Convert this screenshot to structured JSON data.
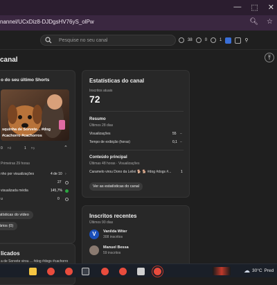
{
  "browser": {
    "url": "nannel/UCxDiz8-DJDgsHV76yS_olPw",
    "controls": [
      "—",
      "⬚",
      "✕"
    ]
  },
  "header": {
    "search_placeholder": "Pesquise no seu canal",
    "stats": [
      "38",
      "0",
      "1"
    ]
  },
  "page": {
    "title": "canal"
  },
  "latest_short": {
    "title": "o do seu último Shorts",
    "video_caption_1": "squinha de Sorvete... #dog",
    "video_caption_2": "#cachorro #cachorros",
    "stat_counts": [
      "0",
      "1"
    ],
    "period": "Primeiras 29 horas",
    "metrics": [
      {
        "label": "nho por visualizações",
        "value": "4 de 10"
      },
      {
        "label": "",
        "value": "27"
      },
      {
        "label": "visualizada média",
        "value": "145,7%"
      },
      {
        "label": "u",
        "value": "0"
      }
    ],
    "analytics_button": "atísticas do vídeo",
    "comments_button": "ários (0)"
  },
  "channel_stats": {
    "title": "Estatísticas do canal",
    "subs_label": "Inscritos atuais",
    "subs_value": "72",
    "summary_title": "Resumo",
    "summary_period": "Últimos 28 dias",
    "rows": [
      {
        "label": "Visualizações",
        "value": "55"
      },
      {
        "label": "Tempo de exibição (horas)",
        "value": "0,1"
      }
    ],
    "top_title": "Conteúdo principal",
    "top_period": "Últimas 48 horas · Visualizações",
    "top_item": "Caramelo virou Dono da Leilei 🐕 🐕 #dog #dogs #...",
    "top_item_value": "1",
    "stats_button": "Ver as estatísticas do canal"
  },
  "recent_subs": {
    "title": "Inscritos recentes",
    "period": "Últimos 90 dias",
    "items": [
      {
        "name": "Vanilda Witer",
        "subs": "308 inscritos",
        "color": "#1a4fb8"
      },
      {
        "name": "Manuel Bessa",
        "subs": "59 inscritos",
        "color": "#8a7a70"
      }
    ]
  },
  "published": {
    "title": "licados",
    "line": "a de Sorvete virou ... #dog #dogs #cachorro"
  },
  "taskbar": {
    "temperature": "30°C",
    "weather_text": "Pred"
  },
  "colors": {
    "accent_green": "#2ba640",
    "tab_bar": "#2b1d2f",
    "address_bar": "#3a2740"
  }
}
